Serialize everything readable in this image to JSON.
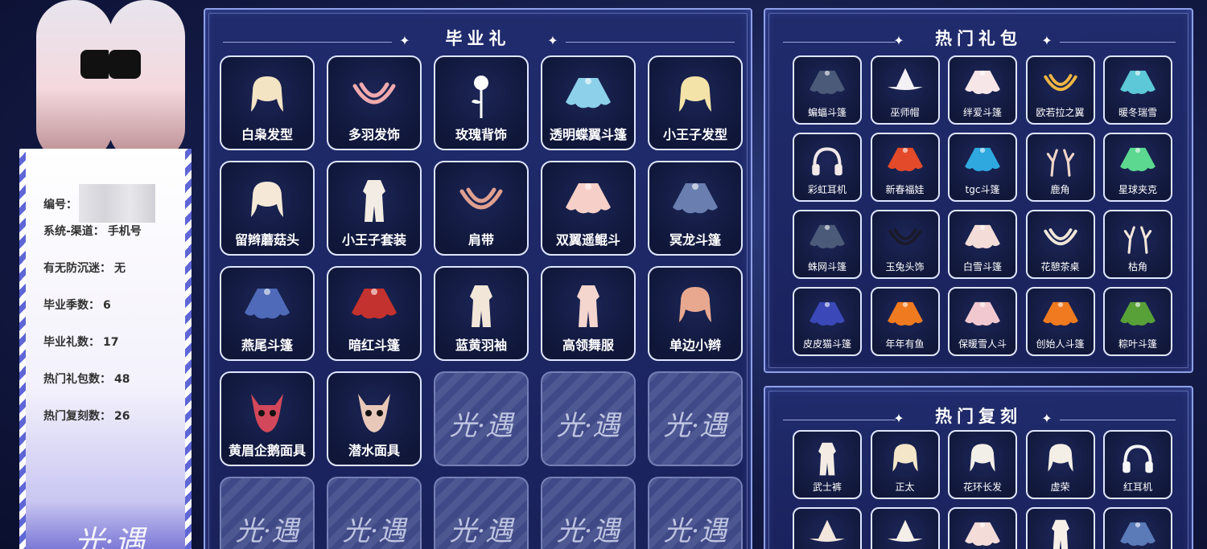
{
  "profile": {
    "id_label": "编号：",
    "rows": [
      {
        "label": "系统-渠道：",
        "value": "手机号"
      },
      {
        "label": "有无防沉迷：",
        "value": "无"
      },
      {
        "label": "毕业季数：",
        "value": "6"
      },
      {
        "label": "毕业礼数：",
        "value": "17"
      },
      {
        "label": "热门礼包数：",
        "value": "48"
      },
      {
        "label": "热门复刻数：",
        "value": "26"
      }
    ],
    "logo_text": "光·遇"
  },
  "graduation": {
    "title": "毕业礼",
    "placeholder_text": "光·遇",
    "items": [
      {
        "label": "白枭发型",
        "icon": "owl-hair-icon",
        "color": "#f3e4c4"
      },
      {
        "label": "多羽发饰",
        "icon": "feather-headband-icon",
        "color": "#f0a9ad"
      },
      {
        "label": "玫瑰背饰",
        "icon": "rose-icon",
        "color": "#ffffff"
      },
      {
        "label": "透明蝶翼斗篷",
        "icon": "butterfly-cape-icon",
        "color": "#8cd0ea"
      },
      {
        "label": "小王子发型",
        "icon": "little-prince-hair-icon",
        "color": "#f4e3a8"
      },
      {
        "label": "留辫蘑菇头",
        "icon": "mushroom-braid-hair-icon",
        "color": "#f5e8d6"
      },
      {
        "label": "小王子套装",
        "icon": "little-prince-outfit-icon",
        "color": "#f3ece4"
      },
      {
        "label": "肩带",
        "icon": "shoulder-strap-icon",
        "color": "#e0a090"
      },
      {
        "label": "双翼遥鲲斗",
        "icon": "double-wing-cape-icon",
        "color": "#f6d0c8"
      },
      {
        "label": "冥龙斗篷",
        "icon": "krill-cape-icon",
        "color": "#6a7fb0"
      },
      {
        "label": "燕尾斗篷",
        "icon": "swallowtail-cape-icon",
        "color": "#4e6ab8"
      },
      {
        "label": "暗红斗篷",
        "icon": "dark-red-cape-icon",
        "color": "#c3322e"
      },
      {
        "label": "蓝黄羽袖",
        "icon": "feather-sleeve-outfit-icon",
        "color": "#f1e6d8"
      },
      {
        "label": "高领舞服",
        "icon": "dance-dress-icon",
        "color": "#f4d6cf"
      },
      {
        "label": "单边小辫",
        "icon": "side-braid-icon",
        "color": "#e8a890"
      },
      {
        "label": "黄眉企鹅面具",
        "icon": "penguin-mask-icon",
        "color": "#d2485a"
      },
      {
        "label": "潜水面具",
        "icon": "diving-mask-icon",
        "color": "#e8c8b8"
      }
    ],
    "empty_slots": 8
  },
  "hot_packs": {
    "title": "热门礼包",
    "items": [
      {
        "label": "蝙蝠斗篷",
        "icon": "bat-cape-icon",
        "color": "#4a5a78"
      },
      {
        "label": "巫师帽",
        "icon": "wizard-hat-icon",
        "color": "#f4f1f6"
      },
      {
        "label": "绊爱斗篷",
        "icon": "heart-cape-icon",
        "color": "#f6e6e8"
      },
      {
        "label": "欧若拉之翼",
        "icon": "aurora-wings-icon",
        "color": "#f0b640"
      },
      {
        "label": "暖冬瑞雪",
        "icon": "winter-cape-icon",
        "color": "#5cc8d8"
      },
      {
        "label": "彩虹耳机",
        "icon": "rainbow-headphones-icon",
        "color": "#f2e8e8"
      },
      {
        "label": "新春福娃",
        "icon": "spring-cape-icon",
        "color": "#e24a2a"
      },
      {
        "label": "tgc斗篷",
        "icon": "tgc-cape-icon",
        "color": "#2fa8e0"
      },
      {
        "label": "鹿角",
        "icon": "deer-antler-icon",
        "color": "#f2d6c8"
      },
      {
        "label": "星球夹克",
        "icon": "planet-jacket-icon",
        "color": "#5cd890"
      },
      {
        "label": "蛛网斗篷",
        "icon": "spider-web-cape-icon",
        "color": "#4a5a78"
      },
      {
        "label": "玉兔头饰",
        "icon": "rabbit-headpiece-icon",
        "color": "#1a1a2a"
      },
      {
        "label": "白雪斗篷",
        "icon": "snow-cape-icon",
        "color": "#f4dcd8"
      },
      {
        "label": "花憩茶桌",
        "icon": "tea-table-icon",
        "color": "#f0e6d8"
      },
      {
        "label": "枯角",
        "icon": "dry-antler-icon",
        "color": "#f2e6da"
      },
      {
        "label": "皮皮猫斗篷",
        "icon": "cat-cape-icon",
        "color": "#3a48b8"
      },
      {
        "label": "年年有鱼",
        "icon": "fish-cape-icon",
        "color": "#f07a20"
      },
      {
        "label": "保暖雪人斗",
        "icon": "snowman-cape-icon",
        "color": "#f2c8d0"
      },
      {
        "label": "创始人斗篷",
        "icon": "founder-cape-icon",
        "color": "#f07a20"
      },
      {
        "label": "粽叶斗篷",
        "icon": "zongzi-cape-icon",
        "color": "#58a038"
      }
    ]
  },
  "hot_reruns": {
    "title": "热门复刻",
    "items": [
      {
        "label": "武士裤",
        "icon": "samurai-pants-icon",
        "color": "#f4ece4"
      },
      {
        "label": "正太",
        "icon": "boy-hair-icon",
        "color": "#f4e6c8"
      },
      {
        "label": "花环长发",
        "icon": "flower-crown-hair-icon",
        "color": "#f2efe8"
      },
      {
        "label": "虚荣",
        "icon": "vanity-hair-icon",
        "color": "#f4efe6"
      },
      {
        "label": "红耳机",
        "icon": "red-headphones-icon",
        "color": "#f6f6f6"
      },
      {
        "label": "",
        "icon": "umbrella-icon",
        "color": "#f2e6dc"
      },
      {
        "label": "",
        "icon": "hat-icon",
        "color": "#f4efe8"
      },
      {
        "label": "",
        "icon": "cape-icon",
        "color": "#f4dcd8"
      },
      {
        "label": "",
        "icon": "outfit-icon",
        "color": "#f6efe8"
      },
      {
        "label": "",
        "icon": "blue-cape-icon",
        "color": "#5a7ab8"
      }
    ]
  }
}
